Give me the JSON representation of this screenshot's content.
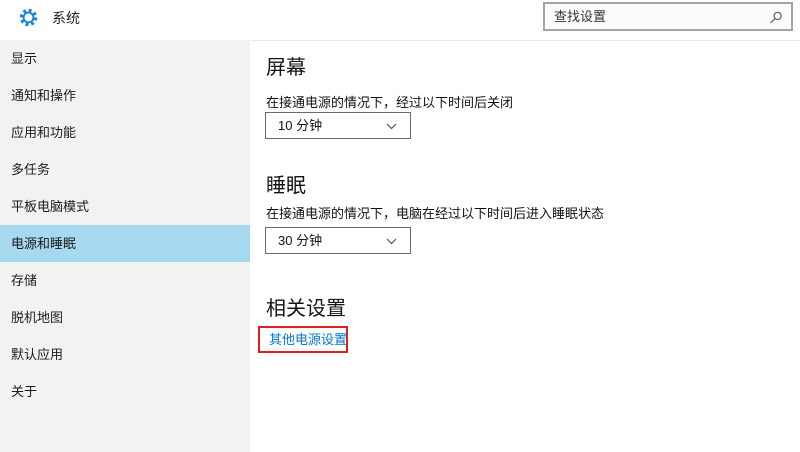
{
  "header": {
    "title": "系统",
    "icon": "settings-gear-icon"
  },
  "search": {
    "placeholder": "查找设置",
    "icon": "search-icon"
  },
  "sidebar": {
    "items": [
      {
        "label": "显示",
        "selected": false
      },
      {
        "label": "通知和操作",
        "selected": false
      },
      {
        "label": "应用和功能",
        "selected": false
      },
      {
        "label": "多任务",
        "selected": false
      },
      {
        "label": "平板电脑模式",
        "selected": false
      },
      {
        "label": "电源和睡眠",
        "selected": true
      },
      {
        "label": "存储",
        "selected": false
      },
      {
        "label": "脱机地图",
        "selected": false
      },
      {
        "label": "默认应用",
        "selected": false
      },
      {
        "label": "关于",
        "selected": false
      }
    ]
  },
  "main": {
    "screen": {
      "heading": "屏幕",
      "description": "在接通电源的情况下，经过以下时间后关闭",
      "dropdown_value": "10 分钟"
    },
    "sleep": {
      "heading": "睡眠",
      "description": "在接通电源的情况下，电脑在经过以下时间后进入睡眠状态",
      "dropdown_value": "30 分钟"
    },
    "related": {
      "heading": "相关设置",
      "link_label": "其他电源设置"
    }
  },
  "colors": {
    "accent_blue": "#1583d5",
    "link_blue": "#0078d7",
    "selected_item_bg": "#a6d8f0",
    "sidebar_bg": "#f2f2f2",
    "annotation_red": "#e0201f"
  }
}
